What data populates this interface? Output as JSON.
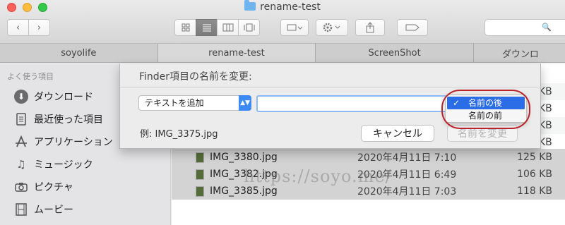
{
  "window": {
    "title": "rename-test"
  },
  "toolbar": {
    "back": "‹",
    "forward": "›",
    "views": [
      "icon-view",
      "list-view",
      "column-view",
      "gallery-view"
    ],
    "search_glyph": "🔍"
  },
  "tabs": [
    "soyolife",
    "rename-test",
    "ScreenShot",
    "ダウンロ"
  ],
  "sidebar": {
    "heading": "よく使う項目",
    "items": [
      {
        "label": "ダウンロード",
        "icon": "download-icon"
      },
      {
        "label": "最近使った項目",
        "icon": "recents-icon"
      },
      {
        "label": "アプリケーション",
        "icon": "applications-icon"
      },
      {
        "label": "ミュージック",
        "icon": "music-icon"
      },
      {
        "label": "ピクチャ",
        "icon": "camera-icon"
      },
      {
        "label": "ムービー",
        "icon": "movie-icon"
      }
    ]
  },
  "files": [
    {
      "name": "IMG_3380.jpg",
      "date": "2020年4月11日 7:10",
      "size": "125 KB"
    },
    {
      "name": "IMG_3382.jpg",
      "date": "2020年4月11日 6:49",
      "size": "106 KB"
    },
    {
      "name": "IMG_3385.jpg",
      "date": "2020年4月11日 7:03",
      "size": "118 KB"
    }
  ],
  "edge_sizes": [
    "KB",
    "KB",
    "KB",
    "KB"
  ],
  "sheet": {
    "title": "Finder項目の名前を変更:",
    "mode": "テキストを追加",
    "text_value": "",
    "example": "例: IMG_3375.jpg",
    "cancel": "キャンセル",
    "rename": "名前を変更"
  },
  "menu": {
    "check": "✓",
    "options": [
      "名前の後",
      "名前の前"
    ],
    "selected_index": 0
  },
  "watermark": "https://soyo.me/",
  "colors": {
    "accent": "#2b6de6",
    "highlight_ring": "#b8242a"
  }
}
